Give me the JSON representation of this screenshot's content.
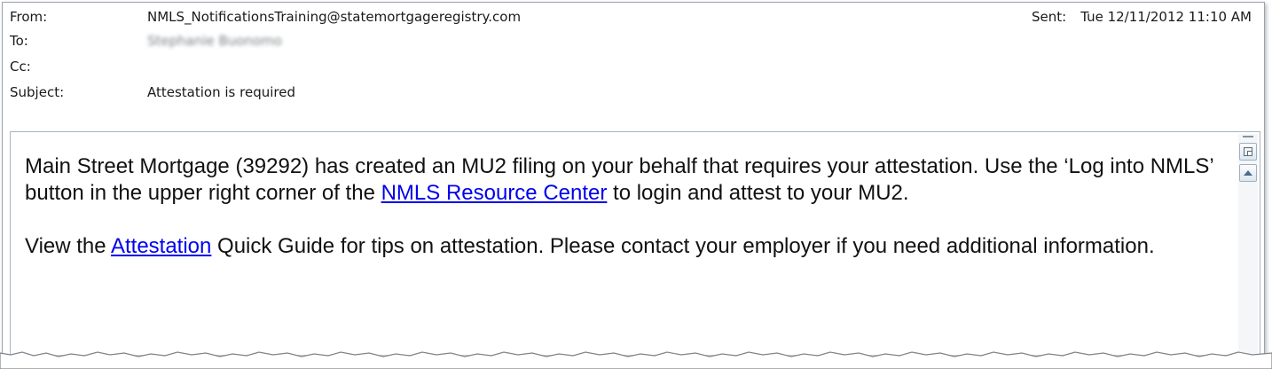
{
  "email": {
    "from_label": "From:",
    "from_value": "NMLS_NotificationsTraining@statemortgageregistry.com",
    "sent_label": "Sent:",
    "sent_value": "Tue 12/11/2012 11:10 AM",
    "to_label": "To:",
    "to_value": "Stephanie Buonomo",
    "cc_label": "Cc:",
    "subject_label": "Subject:",
    "subject_value": "Attestation is required"
  },
  "body": {
    "p1_a": "Main Street Mortgage (39292) has created an MU2 filing on your behalf that requires your attestation. Use the ‘Log into NMLS’ button in the upper right corner of the ",
    "p1_link": "NMLS Resource Center",
    "p1_b": " to login and attest to your MU2.",
    "p2_a": "View the ",
    "p2_link": "Attestation",
    "p2_b": " Quick Guide for tips on attestation. Please contact your employer if you need additional information."
  },
  "icons": {
    "scroll_up": "scroll-up-arrow-icon",
    "view_toggle": "view-toggle-icon"
  },
  "colors": {
    "link": "#0000ee",
    "border": "#a9b4c0"
  }
}
